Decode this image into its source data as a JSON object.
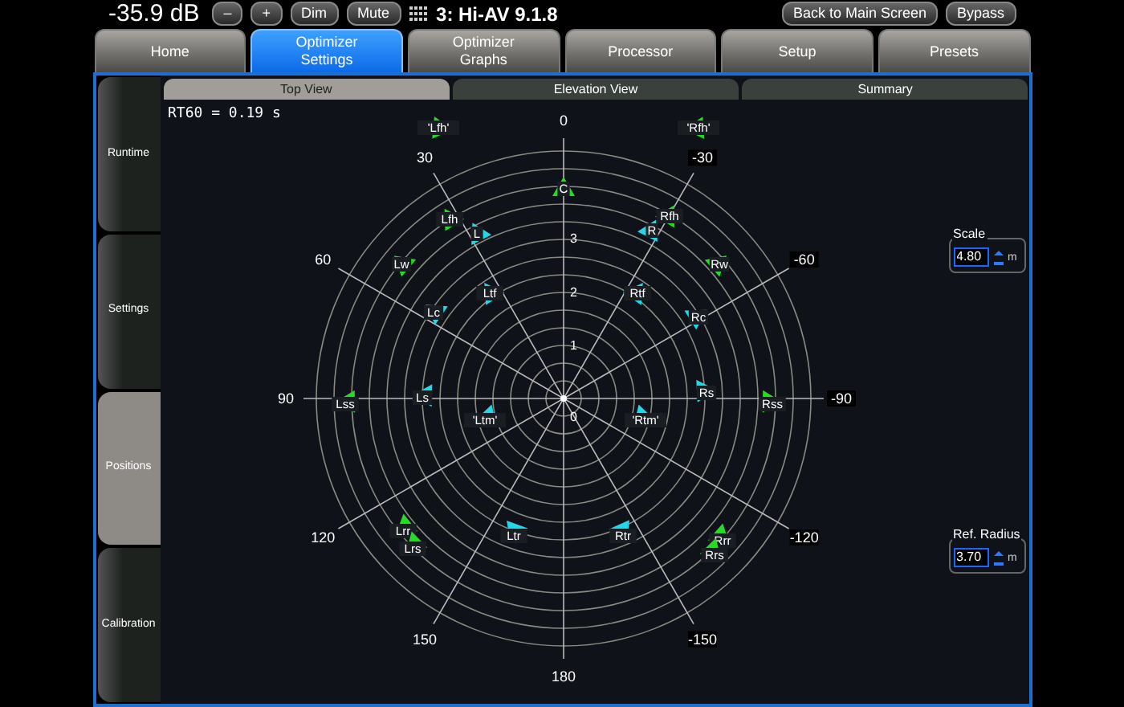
{
  "top_bar": {
    "volume": "-35.9 dB",
    "buttons": [
      {
        "label": "–"
      },
      {
        "label": "+"
      },
      {
        "label": "Dim"
      },
      {
        "label": "Mute"
      }
    ],
    "preset_title": "3: Hi-AV 9.1.8",
    "right_buttons": [
      {
        "label": "Back to Main Screen"
      },
      {
        "label": "Bypass"
      }
    ]
  },
  "tabs": [
    {
      "label": "Home",
      "selected": false
    },
    {
      "label": "Optimizer\nSettings",
      "selected": true
    },
    {
      "label": "Optimizer\nGraphs",
      "selected": false
    },
    {
      "label": "Processor",
      "selected": false
    },
    {
      "label": "Setup",
      "selected": false
    },
    {
      "label": "Presets",
      "selected": false
    }
  ],
  "sidebar": [
    {
      "label": "Runtime",
      "selected": false
    },
    {
      "label": "Settings",
      "selected": false
    },
    {
      "label": "Positions",
      "selected": true
    },
    {
      "label": "Calibration",
      "selected": false
    }
  ],
  "subtabs": [
    {
      "label": "Top View",
      "selected": true
    },
    {
      "label": "Elevation View",
      "selected": false
    },
    {
      "label": "Summary",
      "selected": false
    }
  ],
  "rt60": "RT60 = 0.19 s",
  "plot": {
    "angle_labels": [
      "0",
      "30",
      "60",
      "90",
      "120",
      "150",
      "180",
      "-150",
      "-120",
      "-90",
      "-60",
      "-30"
    ],
    "ring_labels": [
      "3",
      "2",
      "1"
    ],
    "center_label": "0",
    "speakers": [
      {
        "label": "'Lfh'",
        "color": "#22dd22"
      },
      {
        "label": "'Rfh'",
        "color": "#22dd22"
      },
      {
        "label": "C",
        "color": "#22dd22"
      },
      {
        "label": "Lfh",
        "color": "#22dd22"
      },
      {
        "label": "L",
        "color": "#22d8e8"
      },
      {
        "label": "R",
        "color": "#22d8e8"
      },
      {
        "label": "Rfh",
        "color": "#22dd22"
      },
      {
        "label": "Lw",
        "color": "#22dd22"
      },
      {
        "label": "Rw",
        "color": "#22dd22"
      },
      {
        "label": "Ltf",
        "color": "#22d8e8"
      },
      {
        "label": "Rtf",
        "color": "#22d8e8"
      },
      {
        "label": "Lc",
        "color": "#22d8e8"
      },
      {
        "label": "Rc",
        "color": "#22d8e8"
      },
      {
        "label": "Lss",
        "color": "#22dd22"
      },
      {
        "label": "Ls",
        "color": "#22d8e8"
      },
      {
        "label": "Rs",
        "color": "#22d8e8"
      },
      {
        "label": "Rss",
        "color": "#22dd22"
      },
      {
        "label": "'Ltm'",
        "color": "#22d8e8"
      },
      {
        "label": "'Rtm'",
        "color": "#22d8e8"
      },
      {
        "label": "Lrr",
        "color": "#22dd22"
      },
      {
        "label": "Lrs",
        "color": "#22dd22"
      },
      {
        "label": "Ltr",
        "color": "#22d8e8"
      },
      {
        "label": "Rtr",
        "color": "#22d8e8"
      },
      {
        "label": "Rrr",
        "color": "#22dd22"
      },
      {
        "label": "Rrs",
        "color": "#22dd22"
      }
    ]
  },
  "scale": {
    "legend": "Scale",
    "value": "4.80",
    "unit": "m"
  },
  "ref_radius": {
    "legend": "Ref. Radius",
    "value": "3.70",
    "unit": "m"
  }
}
